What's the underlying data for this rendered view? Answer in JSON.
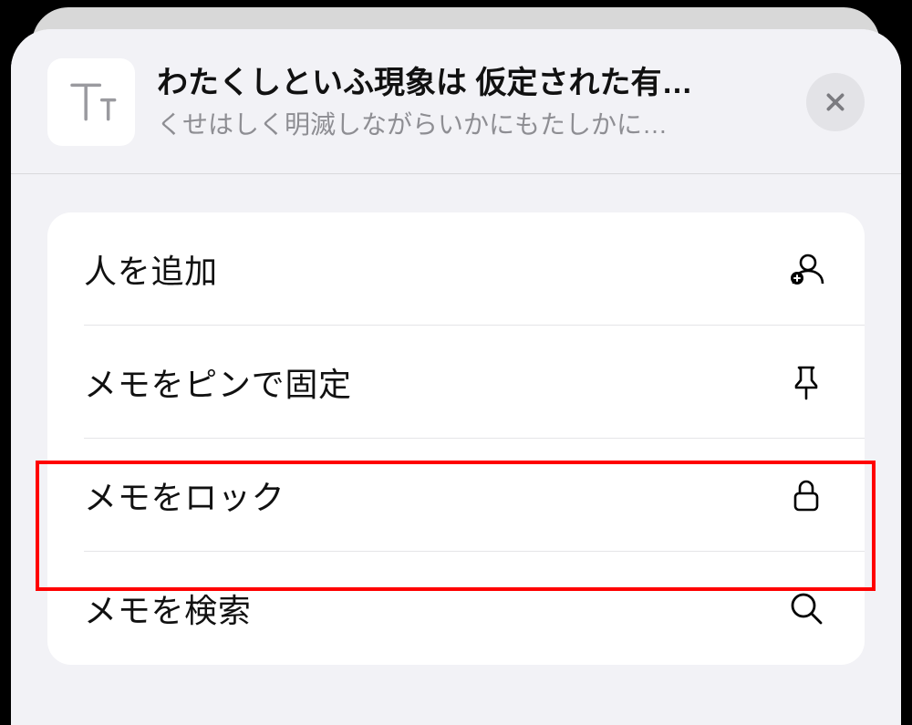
{
  "header": {
    "title": "わたくしといふ現象は 仮定された有…",
    "subtitle": "くせはしく明滅しながらいかにもたしかに…"
  },
  "menu": {
    "add_person": "人を追加",
    "pin_note": "メモをピンで固定",
    "lock_note": "メモをロック",
    "search_note": "メモを検索"
  },
  "icons": {
    "thumb": "text-icon",
    "close": "close-icon",
    "add_person": "person-add-icon",
    "pin": "pin-icon",
    "lock": "lock-icon",
    "search": "search-icon"
  },
  "highlight_index": 2
}
